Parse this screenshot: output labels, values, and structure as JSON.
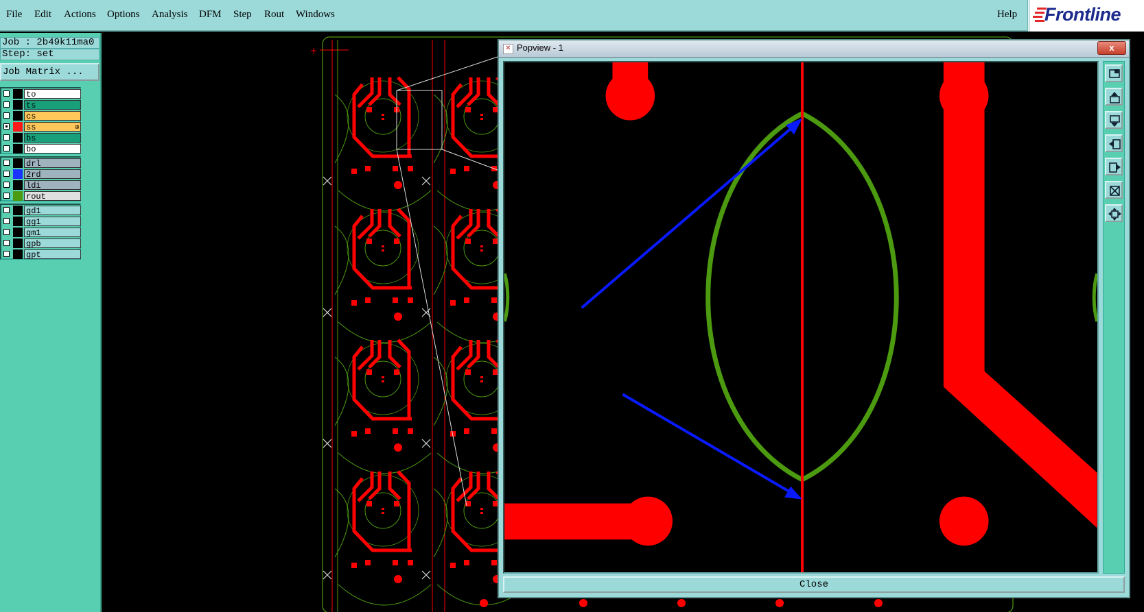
{
  "menubar": {
    "items": [
      "File",
      "Edit",
      "Actions",
      "Options",
      "Analysis",
      "DFM",
      "Step",
      "Rout",
      "Windows"
    ],
    "help": "Help",
    "logo": "Frontline"
  },
  "leftpanel": {
    "job": "Job : 2b49k11ma0",
    "step": "Step: set",
    "job_matrix": "Job Matrix ...",
    "layer_groups": [
      [
        {
          "name": "to",
          "color": "#000000",
          "bg": "#ffffff",
          "checked": false
        },
        {
          "name": "ts",
          "color": "#000000",
          "bg": "#17a07a",
          "checked": false
        },
        {
          "name": "cs",
          "color": "#000000",
          "bg": "#ffc65a",
          "checked": false
        },
        {
          "name": "ss",
          "color": "#ff1a1a",
          "bg": "#ffc65a",
          "checked": true
        },
        {
          "name": "bs",
          "color": "#000000",
          "bg": "#17a07a",
          "checked": false
        },
        {
          "name": "bo",
          "color": "#000000",
          "bg": "#ffffff",
          "checked": false
        }
      ],
      [
        {
          "name": "drl",
          "color": "#000000",
          "bg": "#9fb3bf",
          "checked": false
        },
        {
          "name": "2rd",
          "color": "#1a33ff",
          "bg": "#9fb3bf",
          "checked": false
        },
        {
          "name": "ldi",
          "color": "#000000",
          "bg": "#9fb3bf",
          "checked": false
        },
        {
          "name": "rout",
          "color": "#4c9a10",
          "bg": "#e0e0e0",
          "checked": false
        }
      ],
      [
        {
          "name": "gd1",
          "color": "#000000",
          "bg": "#9cd9d9",
          "checked": false
        },
        {
          "name": "gg1",
          "color": "#000000",
          "bg": "#9cd9d9",
          "checked": false
        },
        {
          "name": "gm1",
          "color": "#000000",
          "bg": "#9cd9d9",
          "checked": false
        },
        {
          "name": "gpb",
          "color": "#000000",
          "bg": "#9cd9d9",
          "checked": false
        },
        {
          "name": "gpt",
          "color": "#000000",
          "bg": "#9cd9d9",
          "checked": false
        }
      ]
    ]
  },
  "popview": {
    "title": "Popview - 1",
    "close_label": "Close",
    "title_close": "x",
    "tools": [
      "zoom-home-icon",
      "zoom-in-icon",
      "zoom-out-icon",
      "pan-left-icon",
      "pan-right-icon",
      "fit-icon",
      "zoom-area-icon"
    ]
  },
  "colors": {
    "copper": "#ff0000",
    "rout": "#4c9a10",
    "marker": "#0a1aff",
    "panel": "#58cfb0",
    "menubar": "#9cd9d9"
  }
}
